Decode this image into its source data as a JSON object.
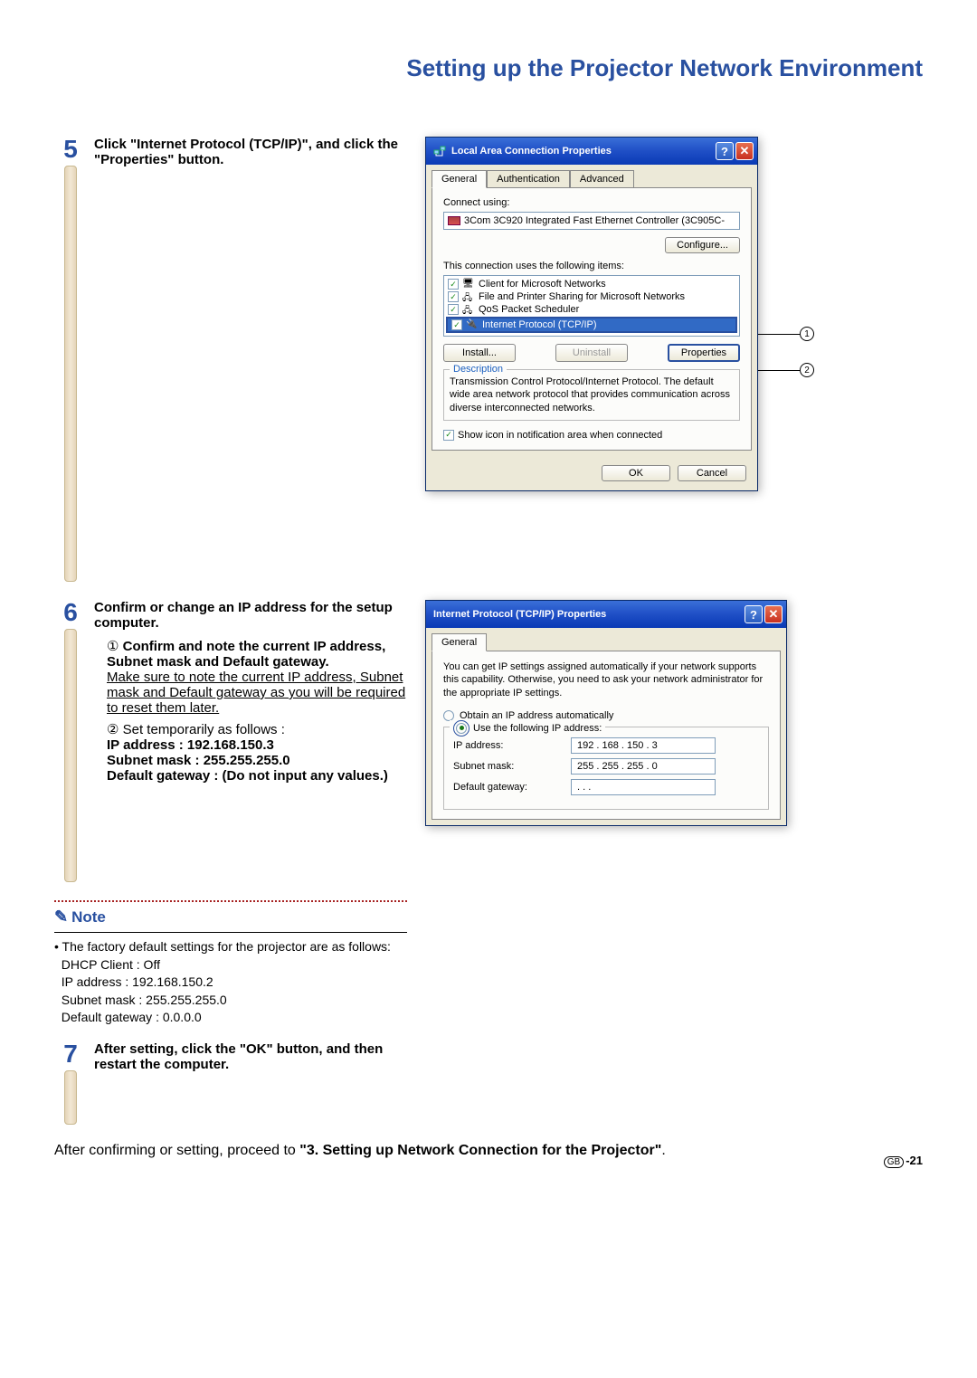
{
  "page_title": "Setting up the Projector Network Environment",
  "step5": {
    "num": "5",
    "heading": "Click \"Internet Protocol (TCP/IP)\", and click the \"Properties\" button."
  },
  "step6": {
    "num": "6",
    "heading": "Confirm or change an IP address for the setup computer.",
    "sub1_num": "①",
    "sub1_bold": "Confirm and note the current IP address, Subnet mask and Default gateway.",
    "sub1_rest": "Make sure to note the current IP address, Subnet mask and Default gateway as you will be required to reset them later.",
    "sub2_num": "②",
    "sub2_text": "Set  temporarily as follows :",
    "ip_line": "IP address : 192.168.150.3",
    "sm_line": "Subnet mask : 255.255.255.0",
    "dg_line": "Default gateway : (Do not input any values.)"
  },
  "note": {
    "label": "Note",
    "intro": "The factory default settings for the projector are as follows:",
    "dhcp": "DHCP Client : Off",
    "ip": "IP address : 192.168.150.2",
    "sm": "Subnet mask : 255.255.255.0",
    "dg": "Default gateway : 0.0.0.0"
  },
  "step7": {
    "num": "7",
    "heading": "After setting, click the \"OK\" button, and then restart the computer."
  },
  "final": {
    "pre": "After confirming or setting, proceed to ",
    "bold": "\"3. Setting up Network Connection for the Projector\"",
    "post": "."
  },
  "dialog1": {
    "title": "Local Area Connection Properties",
    "tab_general": "General",
    "tab_auth": "Authentication",
    "tab_adv": "Advanced",
    "connect_using": "Connect using:",
    "adapter": "3Com 3C920 Integrated Fast Ethernet Controller (3C905C-",
    "configure": "Configure...",
    "uses_items": "This connection uses the following items:",
    "item1": "Client for Microsoft Networks",
    "item2": "File and Printer Sharing for Microsoft Networks",
    "item3": "QoS Packet Scheduler",
    "item4": "Internet Protocol (TCP/IP)",
    "install": "Install...",
    "uninstall": "Uninstall",
    "properties": "Properties",
    "desc_label": "Description",
    "desc_text": "Transmission Control Protocol/Internet Protocol. The default wide area network protocol that provides communication across diverse interconnected networks.",
    "show_icon": "Show icon in notification area when connected",
    "ok": "OK",
    "cancel": "Cancel"
  },
  "dialog2": {
    "title": "Internet Protocol (TCP/IP) Properties",
    "tab_general": "General",
    "auto_text": "You can get IP settings assigned automatically if your network supports this capability. Otherwise, you need to ask your network administrator for the appropriate IP settings.",
    "radio_auto": "Obtain an IP address automatically",
    "radio_manual": "Use the following IP address:",
    "ip_label": "IP address:",
    "ip_val": "192 . 168 . 150 .   3",
    "sm_label": "Subnet mask:",
    "sm_val": "255 . 255 . 255 .   0",
    "dg_label": "Default gateway:",
    "dg_val": ".        .        ."
  },
  "callouts": {
    "c1": "1",
    "c2": "2"
  },
  "pagenum": {
    "gb": "GB",
    "num": "-21"
  }
}
